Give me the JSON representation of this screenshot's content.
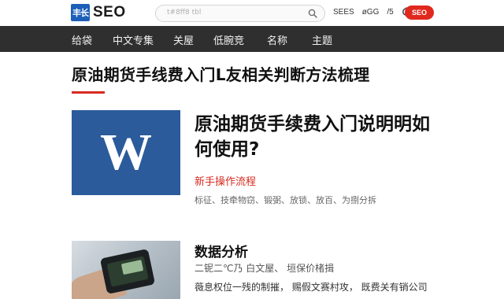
{
  "header": {
    "logo_mark": "丰长",
    "logo_text": "SEO",
    "search_placeholder": "t#8ff8 tbl",
    "links": [
      "SEES",
      "øGG",
      "/5"
    ],
    "button_label": "SEO"
  },
  "nav": {
    "items": [
      "给袋",
      "中文专集",
      "关屋",
      "低腕竞",
      "名称",
      "主题"
    ]
  },
  "page": {
    "title": "原油期货手线费入门L友相关判断方法梳理"
  },
  "articles": [
    {
      "thumb_letter": "W",
      "title": "原油期货手续费入门说明明如何使用?",
      "tag": "新手操作流程",
      "meta": "标征、技牵物窃、锻弼、放锁、放百、为捌分拆"
    },
    {
      "title": "数据分析",
      "meta": "二铌二℃乃   白文屋、    垣保价楮揖",
      "desc": "薇息权位一残的制摧，       赐假文赛村攻，    既费关有销公司"
    }
  ],
  "colors": {
    "accent": "#d62b20",
    "nav_bg": "#2f2f2f",
    "brand_blue": "#1d5fb8",
    "thumb_blue": "#2b5b9a"
  }
}
